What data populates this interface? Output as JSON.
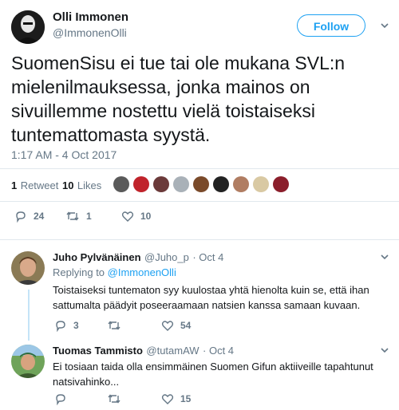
{
  "tweet": {
    "author_name": "Olli Immonen",
    "author_handle": "@ImmonenOlli",
    "follow_label": "Follow",
    "text": "SuomenSisu ei tue tai ole mukana SVL:n mielenilmauksessa, jonka mainos on sivuillemme nostettu vielä toistaiseksi tuntemattomasta syystä.",
    "timestamp": "1:17 AM - 4 Oct 2017",
    "retweets_count": "1",
    "retweets_label": "Retweet",
    "likes_count": "10",
    "likes_label": "Likes",
    "actions": {
      "reply": "24",
      "retweet": "1",
      "like": "10"
    }
  },
  "replies": [
    {
      "name": "Juho Pylvänäinen",
      "handle": "@Juho_p",
      "date": "· Oct 4",
      "replying_prefix": "Replying to",
      "replying_to": "@ImmonenOlli",
      "text": "Toistaiseksi tuntematon syy kuulostaa yhtä hienolta kuin se, että ihan sattumalta päädyit poseeraamaan natsien kanssa samaan kuvaan.",
      "actions": {
        "reply": "3",
        "retweet": "",
        "like": "54"
      }
    },
    {
      "name": "Tuomas Tammisto",
      "handle": "@tutamAW",
      "date": "· Oct 4",
      "text": "Ei tosiaan taida olla ensimmäinen Suomen Gifun aktiiveille tapahtunut natsivahinko...",
      "actions": {
        "reply": "",
        "retweet": "",
        "like": "15"
      }
    }
  ],
  "colors": {
    "accent": "#1da1f2",
    "muted": "#657786",
    "divider": "#e1e8ed",
    "thread": "#c4e4f7"
  }
}
